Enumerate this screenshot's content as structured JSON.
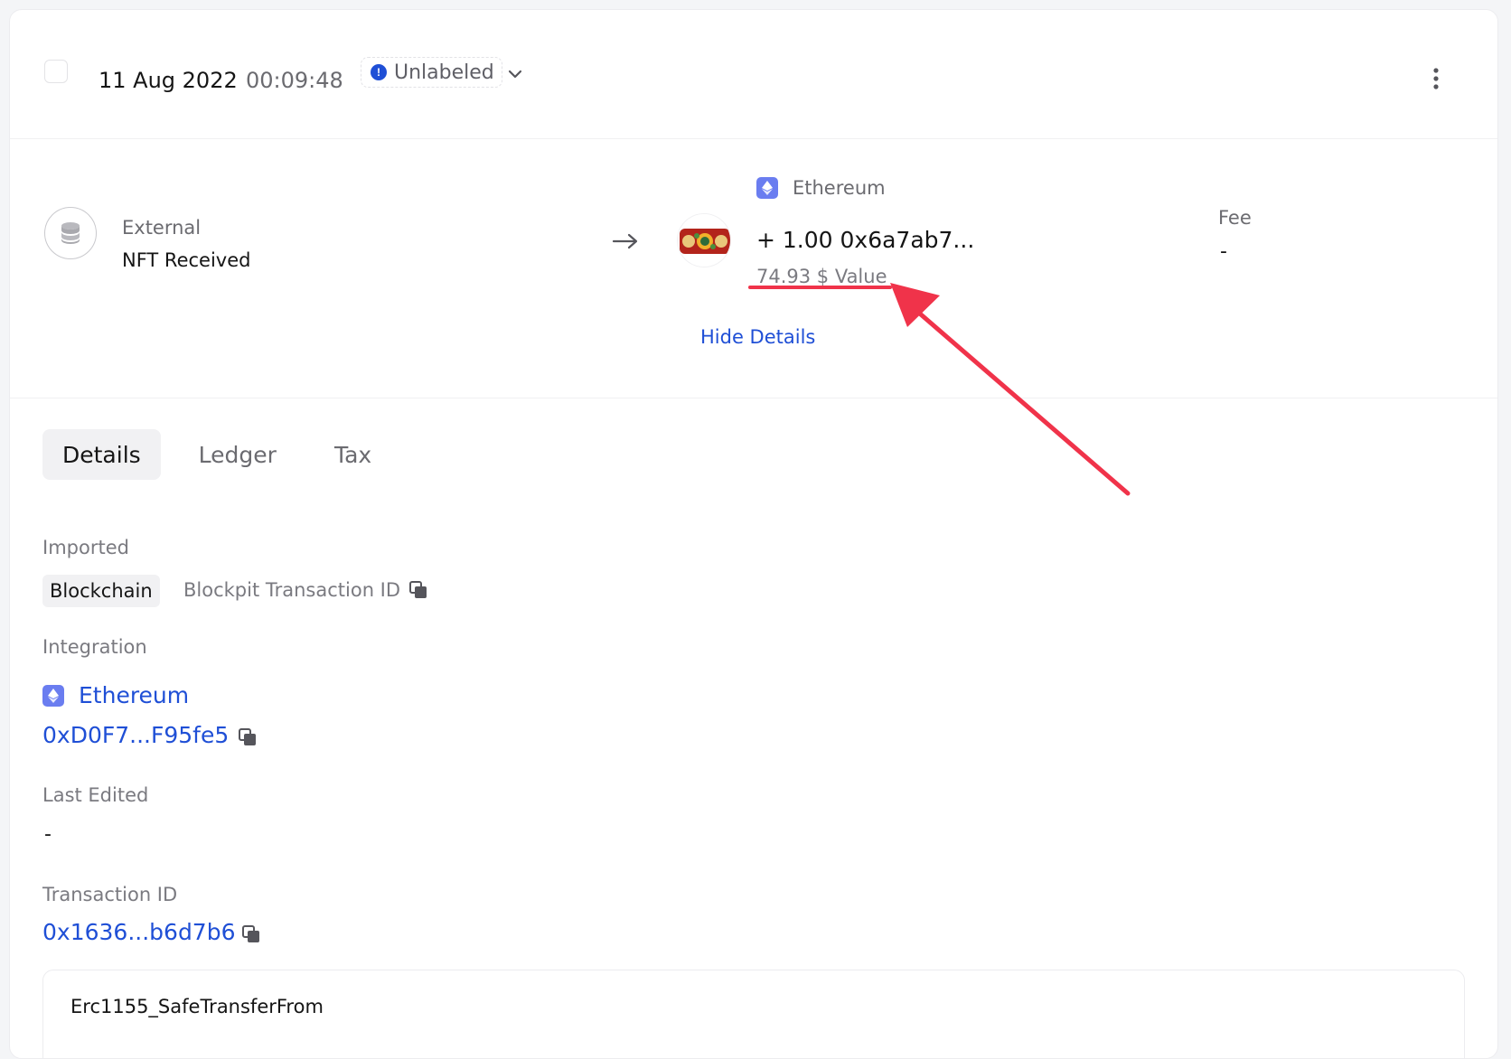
{
  "header": {
    "date": "11 Aug 2022",
    "time": "00:09:48",
    "label": "Unlabeled"
  },
  "summary": {
    "source_title": "External",
    "source_sub": "NFT Received",
    "chain": "Ethereum",
    "amount": "+ 1.00 0x6a7ab7...",
    "value": "74.93 $ Value",
    "fee_label": "Fee",
    "fee_value": "-",
    "hide_details": "Hide Details"
  },
  "tabs": [
    {
      "label": "Details",
      "active": true
    },
    {
      "label": "Ledger",
      "active": false
    },
    {
      "label": "Tax",
      "active": false
    }
  ],
  "details": {
    "imported_label": "Imported",
    "imported_chip": "Blockchain",
    "imported_sub": "Blockpit Transaction ID",
    "integration_label": "Integration",
    "integration_name": "Ethereum",
    "integration_address": "0xD0F7...F95fe5",
    "last_edited_label": "Last Edited",
    "last_edited_value": "-",
    "transaction_id_label": "Transaction ID",
    "transaction_id_value": "0x1636...b6d7b6",
    "method": "Erc1155_SafeTransferFrom"
  },
  "colors": {
    "link": "#1f4fd6",
    "eth_badge": "#6a7df0",
    "annotation": "#f0334a"
  }
}
